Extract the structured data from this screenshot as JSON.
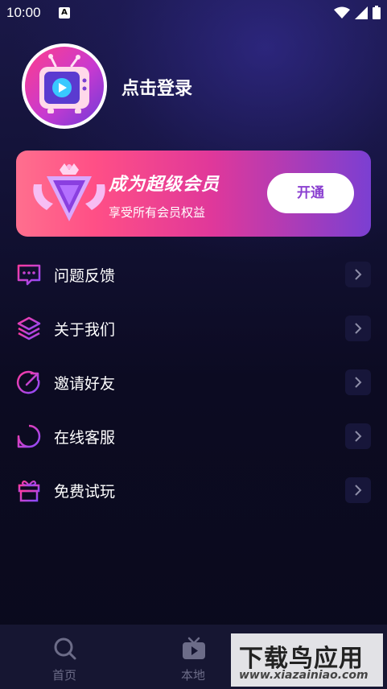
{
  "status_bar": {
    "time": "10:00",
    "notification_badge": "A"
  },
  "profile": {
    "login_label": "点击登录"
  },
  "vip": {
    "title": "成为超级会员",
    "subtitle": "享受所有会员权益",
    "button_label": "开通"
  },
  "menu": {
    "items": [
      {
        "label": "问题反馈",
        "icon": "feedback-icon"
      },
      {
        "label": "关于我们",
        "icon": "layers-icon"
      },
      {
        "label": "邀请好友",
        "icon": "share-icon"
      },
      {
        "label": "在线客服",
        "icon": "chat-icon"
      },
      {
        "label": "免费试玩",
        "icon": "gift-icon"
      }
    ]
  },
  "bottom_nav": {
    "items": [
      {
        "label": "首页",
        "icon": "search-icon"
      },
      {
        "label": "本地",
        "icon": "tv-play-icon"
      }
    ]
  },
  "watermark": {
    "cn": "下载鸟应用",
    "en": "www.xiazainiao.com"
  },
  "colors": {
    "accent_pink": "#ff3d8b",
    "accent_purple": "#7b3fd2",
    "icon_gradient_start": "#ff3aa0",
    "icon_gradient_end": "#8a4bff"
  }
}
